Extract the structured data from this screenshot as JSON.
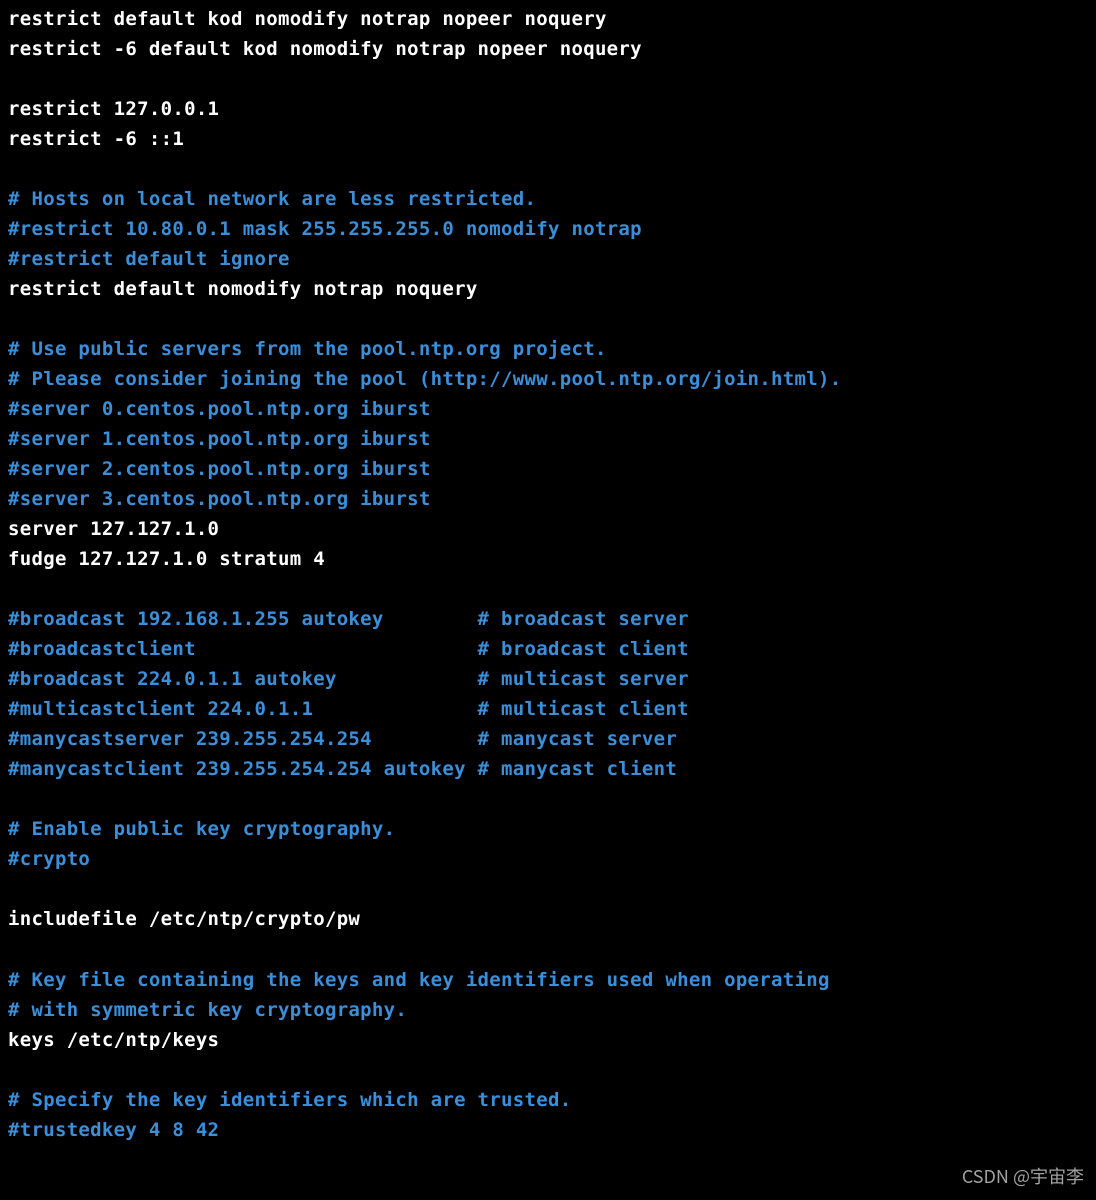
{
  "colors": {
    "background": "#000000",
    "normal_text": "#ffffff",
    "comment_text": "#3b8ed8"
  },
  "lines": [
    {
      "type": "normal",
      "text": "restrict default kod nomodify notrap nopeer noquery"
    },
    {
      "type": "normal",
      "text": "restrict -6 default kod nomodify notrap nopeer noquery"
    },
    {
      "type": "blank",
      "text": ""
    },
    {
      "type": "normal",
      "text": "restrict 127.0.0.1"
    },
    {
      "type": "normal",
      "text": "restrict -6 ::1"
    },
    {
      "type": "blank",
      "text": ""
    },
    {
      "type": "comment",
      "text": "# Hosts on local network are less restricted."
    },
    {
      "type": "comment",
      "text": "#restrict 10.80.0.1 mask 255.255.255.0 nomodify notrap"
    },
    {
      "type": "comment",
      "text": "#restrict default ignore"
    },
    {
      "type": "normal",
      "text": "restrict default nomodify notrap noquery"
    },
    {
      "type": "blank",
      "text": ""
    },
    {
      "type": "comment",
      "text": "# Use public servers from the pool.ntp.org project."
    },
    {
      "type": "comment",
      "text": "# Please consider joining the pool (http://www.pool.ntp.org/join.html)."
    },
    {
      "type": "comment",
      "text": "#server 0.centos.pool.ntp.org iburst"
    },
    {
      "type": "comment",
      "text": "#server 1.centos.pool.ntp.org iburst"
    },
    {
      "type": "comment",
      "text": "#server 2.centos.pool.ntp.org iburst"
    },
    {
      "type": "comment",
      "text": "#server 3.centos.pool.ntp.org iburst"
    },
    {
      "type": "normal",
      "text": "server 127.127.1.0"
    },
    {
      "type": "normal",
      "text": "fudge 127.127.1.0 stratum 4"
    },
    {
      "type": "blank",
      "text": ""
    },
    {
      "type": "comment",
      "text": "#broadcast 192.168.1.255 autokey        # broadcast server"
    },
    {
      "type": "comment",
      "text": "#broadcastclient                        # broadcast client"
    },
    {
      "type": "comment",
      "text": "#broadcast 224.0.1.1 autokey            # multicast server"
    },
    {
      "type": "comment",
      "text": "#multicastclient 224.0.1.1              # multicast client"
    },
    {
      "type": "comment",
      "text": "#manycastserver 239.255.254.254         # manycast server"
    },
    {
      "type": "comment",
      "text": "#manycastclient 239.255.254.254 autokey # manycast client"
    },
    {
      "type": "blank",
      "text": ""
    },
    {
      "type": "comment",
      "text": "# Enable public key cryptography."
    },
    {
      "type": "comment",
      "text": "#crypto"
    },
    {
      "type": "blank",
      "text": ""
    },
    {
      "type": "normal",
      "text": "includefile /etc/ntp/crypto/pw"
    },
    {
      "type": "blank",
      "text": ""
    },
    {
      "type": "comment",
      "text": "# Key file containing the keys and key identifiers used when operating"
    },
    {
      "type": "comment",
      "text": "# with symmetric key cryptography."
    },
    {
      "type": "normal",
      "text": "keys /etc/ntp/keys"
    },
    {
      "type": "blank",
      "text": ""
    },
    {
      "type": "comment",
      "text": "# Specify the key identifiers which are trusted."
    },
    {
      "type": "comment",
      "text": "#trustedkey 4 8 42"
    }
  ],
  "watermark": "CSDN @宇宙李"
}
